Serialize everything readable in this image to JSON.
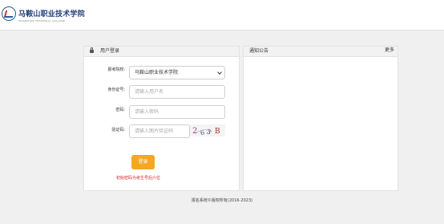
{
  "header": {
    "logo_cn": "马鞍山职业技术学院",
    "logo_en": "MAANSHAN TECHNICAL COLLEGE"
  },
  "login": {
    "title": "用户登录",
    "school_label": "报考院校:",
    "school_value": "马鞍山职业技术学院",
    "id_label": "身份证号:",
    "id_placeholder": "请输入用户名",
    "password_label": "密码:",
    "password_placeholder": "请输入密码",
    "captcha_label": "验证码:",
    "captcha_placeholder": "请输入图片验证码",
    "captcha_text": [
      "2",
      "6",
      "3",
      "B"
    ],
    "submit_label": "登录",
    "hint": "初始密码为考生号后六位"
  },
  "notice": {
    "title": "通知公告",
    "more_label": "更多"
  },
  "footer": {
    "copyright": "报名系统©版权所有(2016-2023)"
  },
  "colors": {
    "accent": "#f5a623",
    "hint": "#d9232b",
    "logo": "#1f3f79"
  }
}
